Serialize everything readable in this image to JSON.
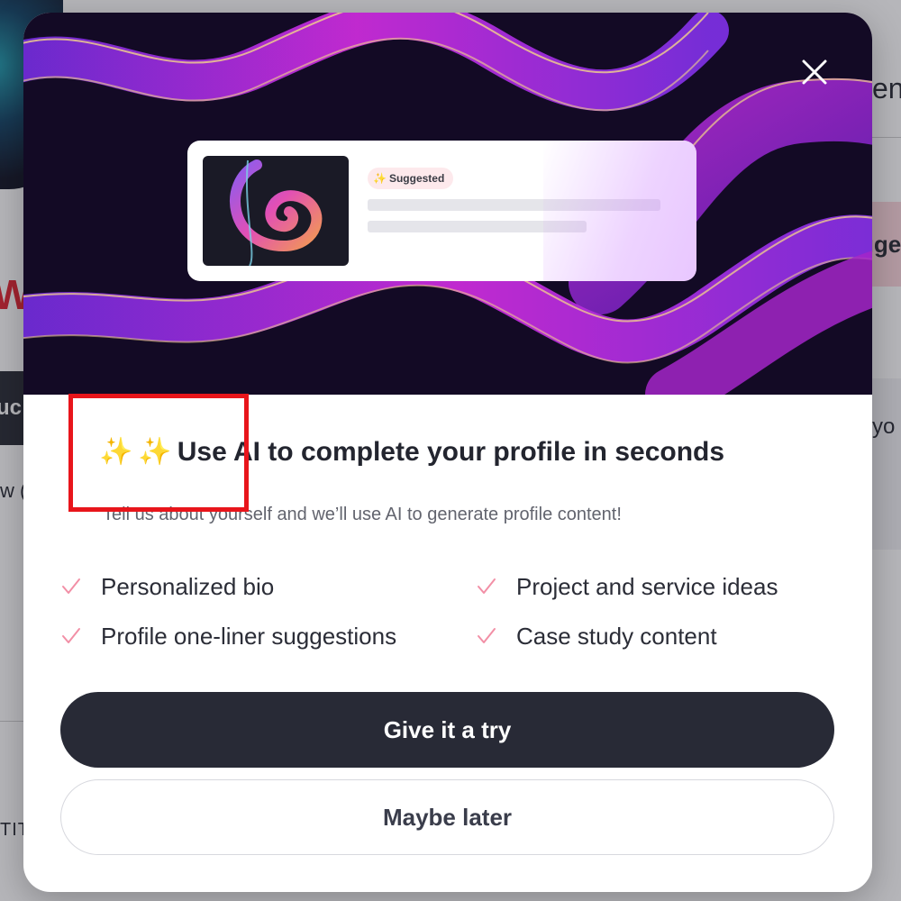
{
  "background": {
    "left_heading_fragment": "W",
    "left_button_fragment": "uc",
    "left_small_text_fragment": "w (",
    "left_caps_fragment": "TIT",
    "right_text_fragment": "en",
    "right_pill_fragment": "gge",
    "right_caption_fragment": "yo"
  },
  "modal": {
    "close_icon": "close-icon",
    "preview": {
      "badge_icon": "sparkles",
      "badge_label": "Suggested"
    },
    "title_emoji_1": "✨",
    "title_emoji_2": "✨",
    "title": "Use AI to complete your profile in seconds",
    "subtitle": "Tell us about yourself and we’ll use AI to generate profile content!",
    "features": [
      {
        "label": "Personalized bio",
        "icon": "check-icon"
      },
      {
        "label": "Project and service ideas",
        "icon": "check-icon"
      },
      {
        "label": "Profile one-liner suggestions",
        "icon": "check-icon"
      },
      {
        "label": "Case study content",
        "icon": "check-icon"
      }
    ],
    "primary_button": "Give it a try",
    "secondary_button": "Maybe later"
  },
  "colors": {
    "accent_check": "#f28fa6",
    "primary_button_bg": "#282a36",
    "hero_bg": "#130a25",
    "highlight": "#e8151b"
  }
}
